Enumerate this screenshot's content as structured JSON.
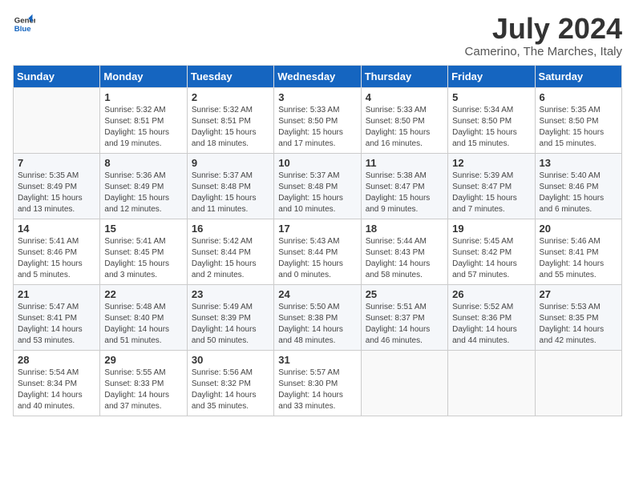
{
  "logo": {
    "line1": "General",
    "line2": "Blue"
  },
  "title": "July 2024",
  "subtitle": "Camerino, The Marches, Italy",
  "header": {
    "days": [
      "Sunday",
      "Monday",
      "Tuesday",
      "Wednesday",
      "Thursday",
      "Friday",
      "Saturday"
    ]
  },
  "weeks": [
    [
      {
        "day": "",
        "info": ""
      },
      {
        "day": "1",
        "info": "Sunrise: 5:32 AM\nSunset: 8:51 PM\nDaylight: 15 hours\nand 19 minutes."
      },
      {
        "day": "2",
        "info": "Sunrise: 5:32 AM\nSunset: 8:51 PM\nDaylight: 15 hours\nand 18 minutes."
      },
      {
        "day": "3",
        "info": "Sunrise: 5:33 AM\nSunset: 8:50 PM\nDaylight: 15 hours\nand 17 minutes."
      },
      {
        "day": "4",
        "info": "Sunrise: 5:33 AM\nSunset: 8:50 PM\nDaylight: 15 hours\nand 16 minutes."
      },
      {
        "day": "5",
        "info": "Sunrise: 5:34 AM\nSunset: 8:50 PM\nDaylight: 15 hours\nand 15 minutes."
      },
      {
        "day": "6",
        "info": "Sunrise: 5:35 AM\nSunset: 8:50 PM\nDaylight: 15 hours\nand 15 minutes."
      }
    ],
    [
      {
        "day": "7",
        "info": "Sunrise: 5:35 AM\nSunset: 8:49 PM\nDaylight: 15 hours\nand 13 minutes."
      },
      {
        "day": "8",
        "info": "Sunrise: 5:36 AM\nSunset: 8:49 PM\nDaylight: 15 hours\nand 12 minutes."
      },
      {
        "day": "9",
        "info": "Sunrise: 5:37 AM\nSunset: 8:48 PM\nDaylight: 15 hours\nand 11 minutes."
      },
      {
        "day": "10",
        "info": "Sunrise: 5:37 AM\nSunset: 8:48 PM\nDaylight: 15 hours\nand 10 minutes."
      },
      {
        "day": "11",
        "info": "Sunrise: 5:38 AM\nSunset: 8:47 PM\nDaylight: 15 hours\nand 9 minutes."
      },
      {
        "day": "12",
        "info": "Sunrise: 5:39 AM\nSunset: 8:47 PM\nDaylight: 15 hours\nand 7 minutes."
      },
      {
        "day": "13",
        "info": "Sunrise: 5:40 AM\nSunset: 8:46 PM\nDaylight: 15 hours\nand 6 minutes."
      }
    ],
    [
      {
        "day": "14",
        "info": "Sunrise: 5:41 AM\nSunset: 8:46 PM\nDaylight: 15 hours\nand 5 minutes."
      },
      {
        "day": "15",
        "info": "Sunrise: 5:41 AM\nSunset: 8:45 PM\nDaylight: 15 hours\nand 3 minutes."
      },
      {
        "day": "16",
        "info": "Sunrise: 5:42 AM\nSunset: 8:44 PM\nDaylight: 15 hours\nand 2 minutes."
      },
      {
        "day": "17",
        "info": "Sunrise: 5:43 AM\nSunset: 8:44 PM\nDaylight: 15 hours\nand 0 minutes."
      },
      {
        "day": "18",
        "info": "Sunrise: 5:44 AM\nSunset: 8:43 PM\nDaylight: 14 hours\nand 58 minutes."
      },
      {
        "day": "19",
        "info": "Sunrise: 5:45 AM\nSunset: 8:42 PM\nDaylight: 14 hours\nand 57 minutes."
      },
      {
        "day": "20",
        "info": "Sunrise: 5:46 AM\nSunset: 8:41 PM\nDaylight: 14 hours\nand 55 minutes."
      }
    ],
    [
      {
        "day": "21",
        "info": "Sunrise: 5:47 AM\nSunset: 8:41 PM\nDaylight: 14 hours\nand 53 minutes."
      },
      {
        "day": "22",
        "info": "Sunrise: 5:48 AM\nSunset: 8:40 PM\nDaylight: 14 hours\nand 51 minutes."
      },
      {
        "day": "23",
        "info": "Sunrise: 5:49 AM\nSunset: 8:39 PM\nDaylight: 14 hours\nand 50 minutes."
      },
      {
        "day": "24",
        "info": "Sunrise: 5:50 AM\nSunset: 8:38 PM\nDaylight: 14 hours\nand 48 minutes."
      },
      {
        "day": "25",
        "info": "Sunrise: 5:51 AM\nSunset: 8:37 PM\nDaylight: 14 hours\nand 46 minutes."
      },
      {
        "day": "26",
        "info": "Sunrise: 5:52 AM\nSunset: 8:36 PM\nDaylight: 14 hours\nand 44 minutes."
      },
      {
        "day": "27",
        "info": "Sunrise: 5:53 AM\nSunset: 8:35 PM\nDaylight: 14 hours\nand 42 minutes."
      }
    ],
    [
      {
        "day": "28",
        "info": "Sunrise: 5:54 AM\nSunset: 8:34 PM\nDaylight: 14 hours\nand 40 minutes."
      },
      {
        "day": "29",
        "info": "Sunrise: 5:55 AM\nSunset: 8:33 PM\nDaylight: 14 hours\nand 37 minutes."
      },
      {
        "day": "30",
        "info": "Sunrise: 5:56 AM\nSunset: 8:32 PM\nDaylight: 14 hours\nand 35 minutes."
      },
      {
        "day": "31",
        "info": "Sunrise: 5:57 AM\nSunset: 8:30 PM\nDaylight: 14 hours\nand 33 minutes."
      },
      {
        "day": "",
        "info": ""
      },
      {
        "day": "",
        "info": ""
      },
      {
        "day": "",
        "info": ""
      }
    ]
  ]
}
